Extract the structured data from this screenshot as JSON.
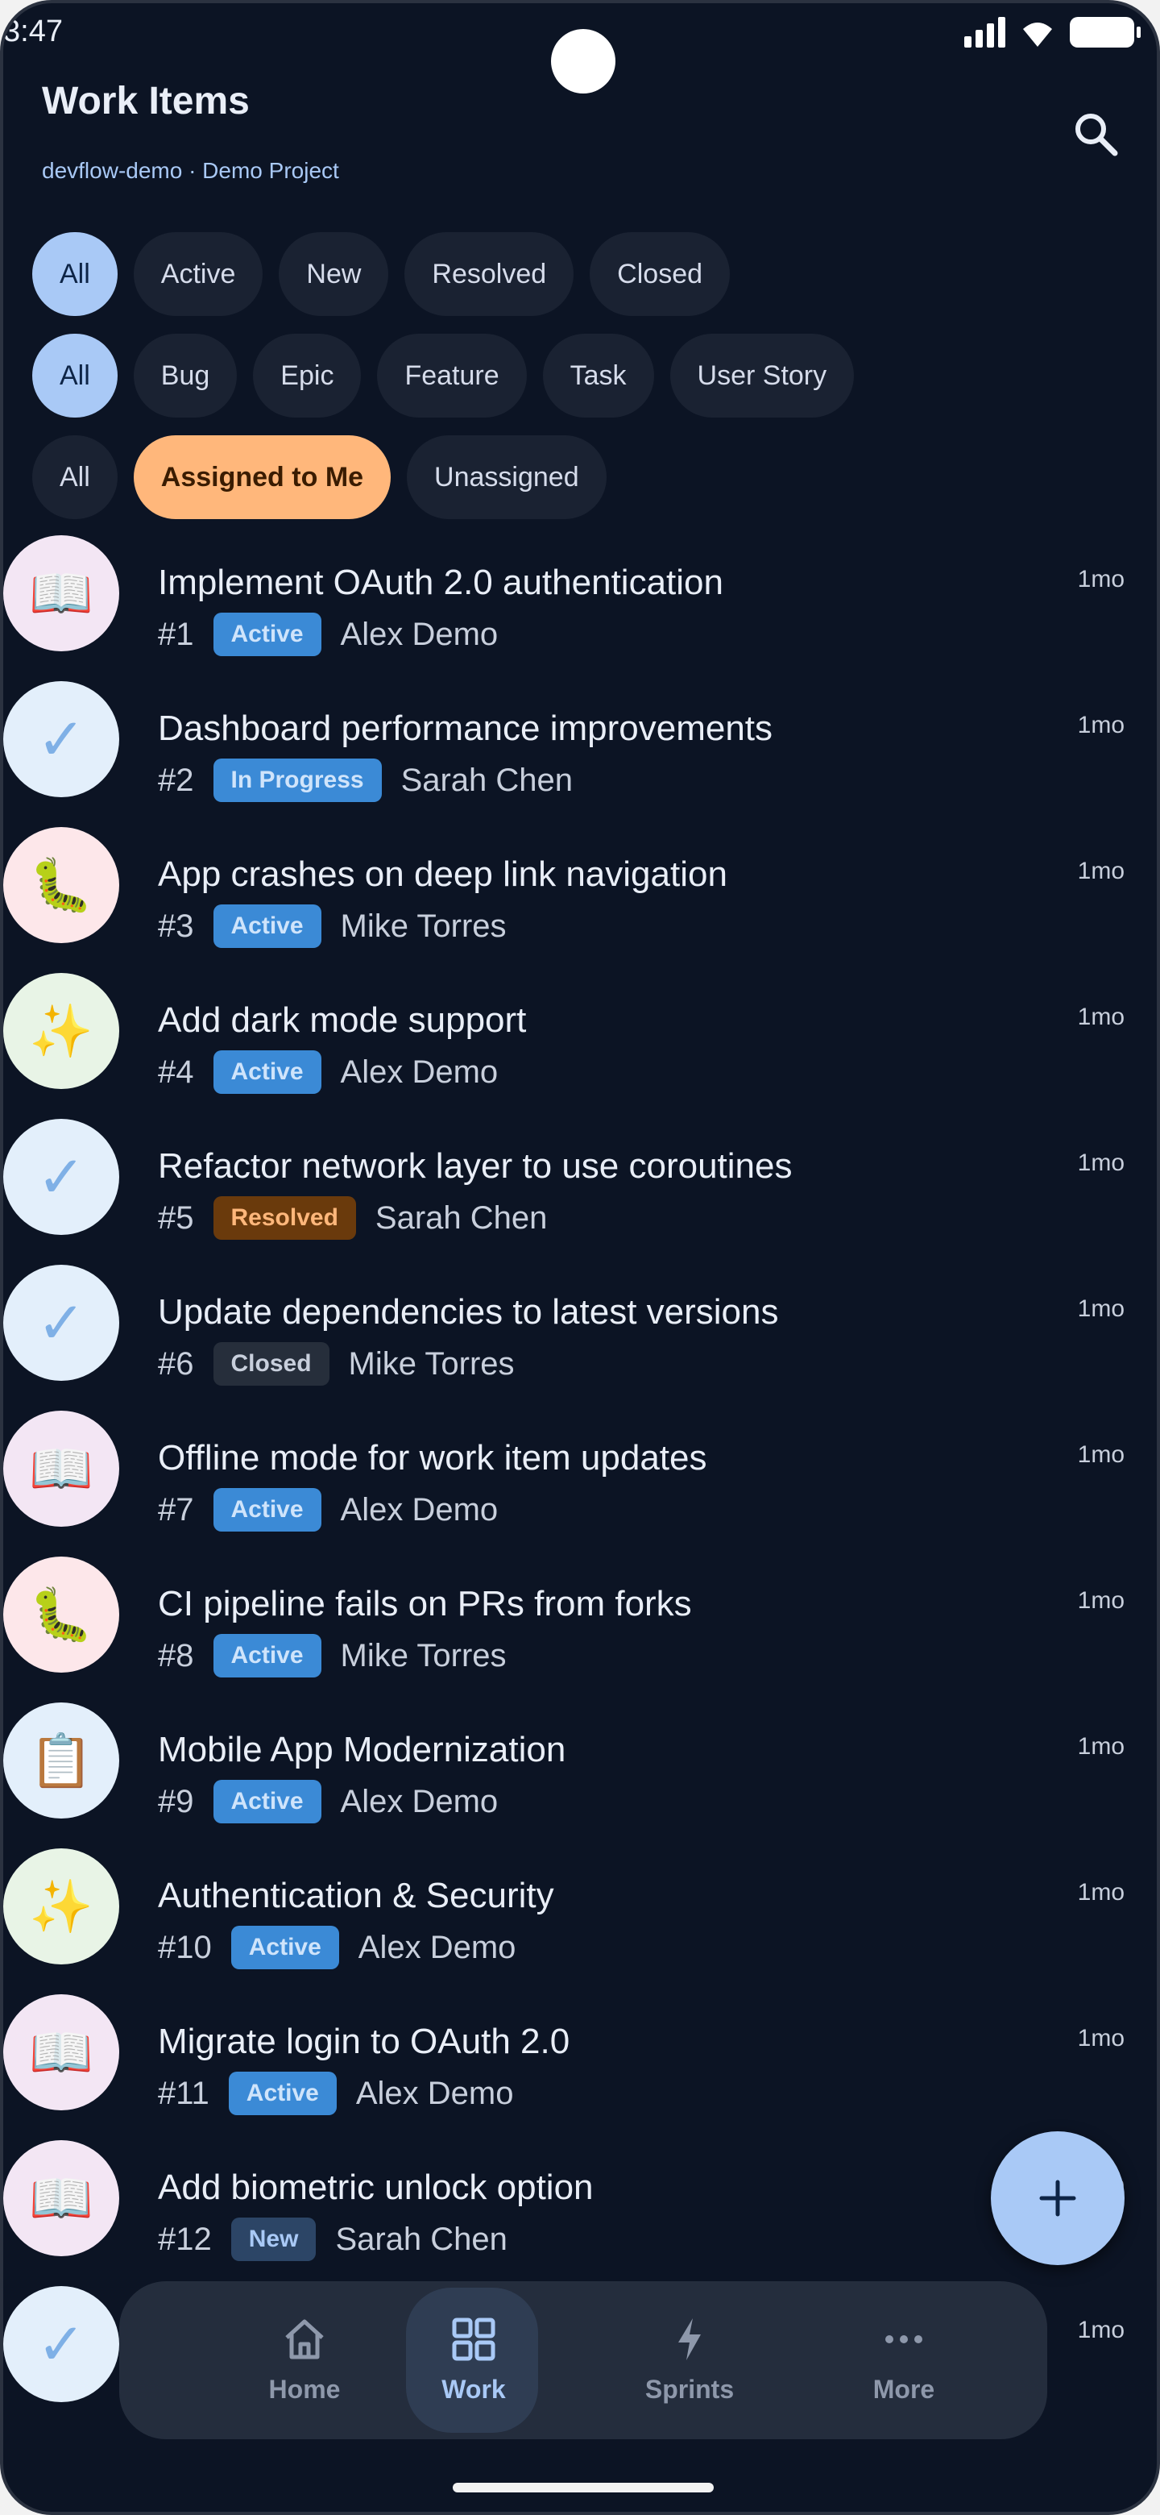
{
  "status_bar": {
    "time": "3:47"
  },
  "header": {
    "title": "Work Items",
    "subtitle": "devflow-demo · Demo Project",
    "search_icon": "search-icon"
  },
  "filters": {
    "state": [
      {
        "label": "All",
        "selected": true
      },
      {
        "label": "Active",
        "selected": false
      },
      {
        "label": "New",
        "selected": false
      },
      {
        "label": "Resolved",
        "selected": false
      },
      {
        "label": "Closed",
        "selected": false
      }
    ],
    "type": [
      {
        "label": "All",
        "selected": true
      },
      {
        "label": "Bug",
        "selected": false
      },
      {
        "label": "Epic",
        "selected": false
      },
      {
        "label": "Feature",
        "selected": false
      },
      {
        "label": "Task",
        "selected": false
      },
      {
        "label": "User Story",
        "selected": false
      }
    ],
    "assignment": [
      {
        "label": "All",
        "selected": false
      },
      {
        "label": "Assigned to Me",
        "selected": true
      },
      {
        "label": "Unassigned",
        "selected": false
      }
    ]
  },
  "status_colors": {
    "Active": {
      "bg": "#3f8fdc",
      "fg": "#8ec3f4"
    },
    "In Progress": {
      "bg": "#3f8fdc",
      "fg": "#8ec3f4"
    },
    "Resolved": {
      "bg": "#6a3a0c",
      "fg": "#ffb77b"
    },
    "Closed": {
      "bg": "#262e3b",
      "fg": "#c8cfdc"
    },
    "New": {
      "bg": "#2c4566",
      "fg": "#a9c9f6"
    }
  },
  "type_icons": {
    "story": {
      "glyph": "📖",
      "bg": "#f3e6f4",
      "icon": "book-icon"
    },
    "task": {
      "glyph": "✓",
      "bg": "#e3effb",
      "icon": "checkmark-icon"
    },
    "bug": {
      "glyph": "🐛",
      "bg": "#fde7ea",
      "icon": "bug-icon"
    },
    "feature": {
      "glyph": "✨",
      "bg": "#e8f4e6",
      "icon": "sparkles-icon"
    },
    "epic": {
      "glyph": "📋",
      "bg": "#e3effb",
      "icon": "clipboard-icon"
    }
  },
  "work_items": [
    {
      "type": "story",
      "title": "Implement OAuth 2.0 authentication",
      "id": "#1",
      "status": "Active",
      "assignee": "Alex Demo",
      "age": "1mo"
    },
    {
      "type": "task",
      "title": "Dashboard performance improvements",
      "id": "#2",
      "status": "In Progress",
      "assignee": "Sarah Chen",
      "age": "1mo"
    },
    {
      "type": "bug",
      "title": "App crashes on deep link navigation",
      "id": "#3",
      "status": "Active",
      "assignee": "Mike Torres",
      "age": "1mo"
    },
    {
      "type": "feature",
      "title": "Add dark mode support",
      "id": "#4",
      "status": "Active",
      "assignee": "Alex Demo",
      "age": "1mo"
    },
    {
      "type": "task",
      "title": "Refactor network layer to use coroutines",
      "id": "#5",
      "status": "Resolved",
      "assignee": "Sarah Chen",
      "age": "1mo"
    },
    {
      "type": "task",
      "title": "Update dependencies to latest versions",
      "id": "#6",
      "status": "Closed",
      "assignee": "Mike Torres",
      "age": "1mo"
    },
    {
      "type": "story",
      "title": "Offline mode for work item updates",
      "id": "#7",
      "status": "Active",
      "assignee": "Alex Demo",
      "age": "1mo"
    },
    {
      "type": "bug",
      "title": "CI pipeline fails on PRs from forks",
      "id": "#8",
      "status": "Active",
      "assignee": "Mike Torres",
      "age": "1mo"
    },
    {
      "type": "epic",
      "title": "Mobile App Modernization",
      "id": "#9",
      "status": "Active",
      "assignee": "Alex Demo",
      "age": "1mo"
    },
    {
      "type": "feature",
      "title": "Authentication & Security",
      "id": "#10",
      "status": "Active",
      "assignee": "Alex Demo",
      "age": "1mo"
    },
    {
      "type": "story",
      "title": "Migrate login to OAuth 2.0",
      "id": "#11",
      "status": "Active",
      "assignee": "Alex Demo",
      "age": "1mo"
    },
    {
      "type": "story",
      "title": "Add biometric unlock option",
      "id": "#12",
      "status": "New",
      "assignee": "Sarah Chen",
      "age": "1mo"
    },
    {
      "type": "task",
      "title": "",
      "id": "",
      "status": "",
      "assignee": "",
      "age": "1mo"
    }
  ],
  "fab": {
    "icon": "plus-icon"
  },
  "bottom_nav": [
    {
      "label": "Home",
      "icon": "home-icon",
      "active": false
    },
    {
      "label": "Work",
      "icon": "grid-icon",
      "active": true
    },
    {
      "label": "Sprints",
      "icon": "lightning-icon",
      "active": false
    },
    {
      "label": "More",
      "icon": "more-icon",
      "active": false
    }
  ]
}
